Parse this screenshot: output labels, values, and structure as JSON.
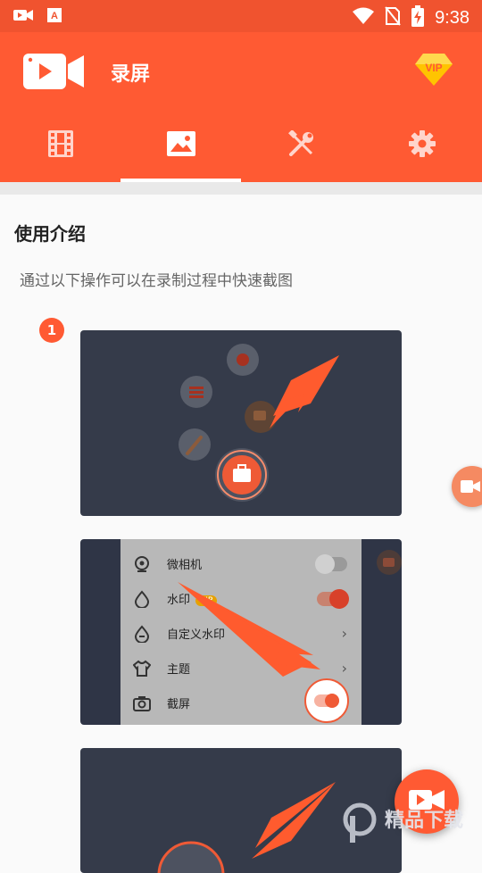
{
  "status_bar": {
    "time": "9:38"
  },
  "app_bar": {
    "title": "录屏",
    "vip_label": "VIP"
  },
  "tabs": [
    {
      "icon": "film-icon",
      "active": false
    },
    {
      "icon": "image-icon",
      "active": true
    },
    {
      "icon": "tools-icon",
      "active": false
    },
    {
      "icon": "gear-icon",
      "active": false
    }
  ],
  "content": {
    "section_title": "使用介绍",
    "description": "通过以下操作可以在录制过程中快速截图",
    "step1": {
      "number": "1"
    },
    "step2": {
      "rows": [
        {
          "label": "微相机",
          "control": "toggle",
          "on": false
        },
        {
          "label": "水印",
          "badge": "VIP",
          "control": "toggle",
          "on": true
        },
        {
          "label": "自定义水印",
          "control": "chevron"
        },
        {
          "label": "主题",
          "control": "chevron"
        },
        {
          "label": "截屏",
          "control": "toggle",
          "on": true
        }
      ]
    }
  },
  "watermark": {
    "text": "精品下载"
  },
  "colors": {
    "brand": "#ff5a33",
    "status_bar": "#f0532f",
    "arrow": "#ff5b2e"
  }
}
